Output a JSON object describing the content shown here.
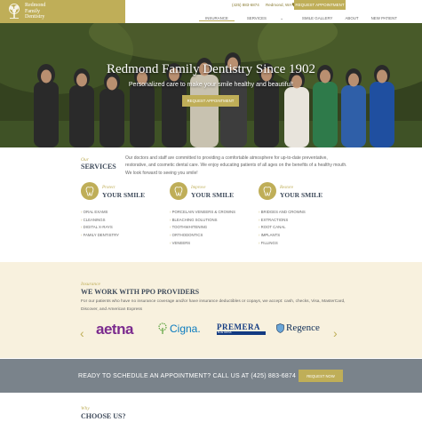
{
  "brand": {
    "name_lines": [
      "Redmond",
      "Family",
      "Dentistry"
    ],
    "accent_color": "#bfae58",
    "heading_color": "#3e4a5a"
  },
  "header": {
    "phone": "(425) 883-6874",
    "location": "Redmond, WA",
    "request_label": "REQUEST APPOINTMENT",
    "nav": [
      "INSURANCE",
      "SERVICES",
      "SMILE GALLERY",
      "ABOUT",
      "NEW PATIENT"
    ],
    "active_nav": "INSURANCE"
  },
  "hero": {
    "title": "Redmond Family Dentistry Since 1902",
    "subtitle": "Personalized care to make your smile healthy and beautiful!",
    "button_label": "REQUEST APPOINTMENT"
  },
  "services": {
    "sup": "Our",
    "title": "SERVICES",
    "description": "Our doctors and staff are committed to providing a comfortable atmosphere for up-to-date preventative, restorative, and cosmetic dental care. We enjoy educating patients of all ages on the benefits of a healthy mouth. We look forward to seeing you smile!",
    "columns": [
      {
        "sup": "Protect",
        "title": "YOUR SMILE",
        "icon": "tooth-icon",
        "items": [
          "ORAL EXAMS",
          "CLEANINGS",
          "DIGITAL X-RAYS",
          "FAMILY DENTISTRY"
        ]
      },
      {
        "sup": "Improve",
        "title": "YOUR SMILE",
        "icon": "tooth-icon",
        "items": [
          "PORCELAIN VENEERS & CROWNS",
          "BLEACHING SOLUTIONS",
          "TOOTHWHITENING",
          "ORTHODONTICS",
          "VENEERS"
        ]
      },
      {
        "sup": "Restore",
        "title": "YOUR SMILE",
        "icon": "tooth-icon",
        "items": [
          "BRIDGES AND CROWNS",
          "EXTRACTIONS",
          "ROOT CANAL",
          "IMPLANTS",
          "FILLINGS"
        ]
      }
    ]
  },
  "insurance": {
    "sup": "Insurance",
    "title": "WE WORK WITH PPO PROVIDERS",
    "description": "For our patients who have no insurance coverage and/or have insurance deductibles or copays, we accept: cash, checks, Visa, MasterCard, Discover, and American Express",
    "logos": {
      "aetna": "aetna",
      "cigna": "Cigna.",
      "premera": "PREMERA",
      "premera_sub": "BLUE CROSS",
      "regence": "Regence"
    }
  },
  "cta": {
    "text": "READY TO SCHEDULE AN APPOINTMENT? CALL US AT (425) 883-6874",
    "button_label": "REQUEST NOW"
  },
  "why": {
    "sup": "Why",
    "title": "CHOOSE US?"
  }
}
